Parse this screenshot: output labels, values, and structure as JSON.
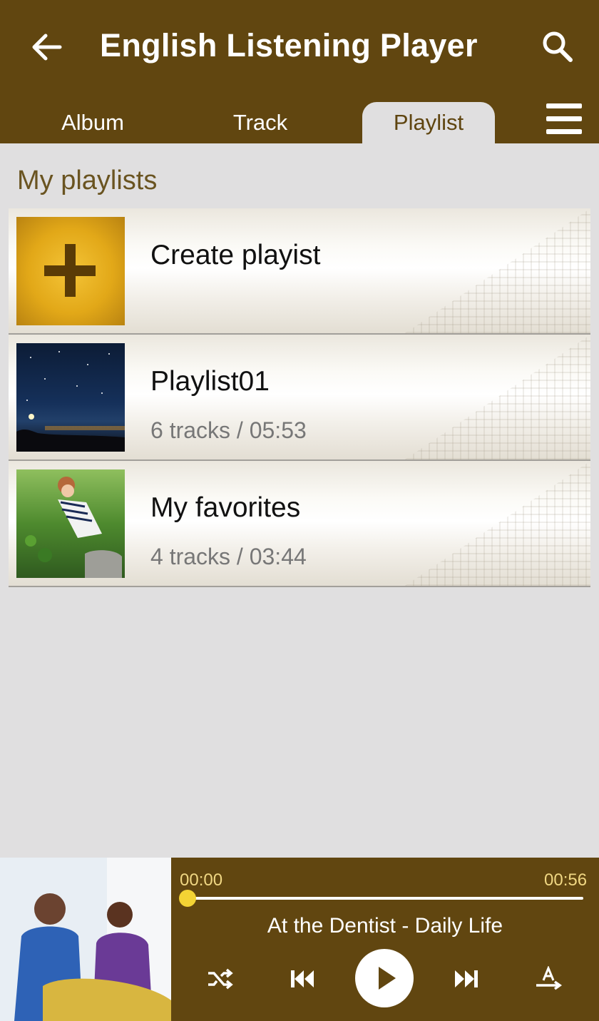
{
  "header": {
    "title": "English Listening Player",
    "back_icon": "arrow-left-icon",
    "search_icon": "search-icon"
  },
  "tabs": [
    {
      "label": "Album",
      "active": false
    },
    {
      "label": "Track",
      "active": false
    },
    {
      "label": "Playlist",
      "active": true
    }
  ],
  "menu_icon": "hamburger-menu-icon",
  "section": {
    "title": "My playlists"
  },
  "playlists": [
    {
      "title": "Create playist",
      "subtitle": ""
    },
    {
      "title": "Playlist01",
      "subtitle": "6 tracks / 05:53"
    },
    {
      "title": "My favorites",
      "subtitle": "4 tracks / 03:44"
    }
  ],
  "player": {
    "time_current": "00:00",
    "time_total": "00:56",
    "progress": 0.0,
    "track": "At the Dentist - Daily Life",
    "controls": [
      "shuffle-icon",
      "previous-icon",
      "play-icon",
      "next-icon",
      "auto-advance-icon"
    ]
  },
  "colors": {
    "header_bg": "#614610",
    "page_bg": "#e0dfe0",
    "accent_yellow": "#f3d334",
    "time_text": "#f0d783",
    "section_title": "#6a5421"
  }
}
